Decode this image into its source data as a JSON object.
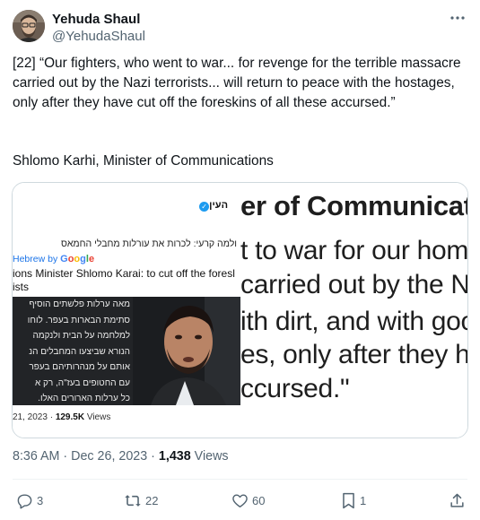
{
  "author": {
    "display_name": "Yehuda Shaul",
    "handle": "@YehudaShaul"
  },
  "tweet": {
    "text": "[22] “Our fighters, who went to war... for revenge for the terrible massacre carried out by the Nazi terrorists... will return to peace with the hostages, only after they have cut off the foreskins of all these accursed.”",
    "signature": "Shlomo Karhi, Minister of Communications"
  },
  "media": {
    "left": {
      "source": "העין",
      "hebrew_headline": "ולמה קרעי: לכרות את עורלות מחבלי החמאס",
      "translated_label": "Hebrew by",
      "google": [
        "G",
        "o",
        "o",
        "g",
        "l",
        "e"
      ],
      "english_headline_1": "ions Minister Shlomo Karai: to cut off the foresl",
      "english_headline_2": "ists",
      "hebrew_block": [
        "מאה ערלות פלשתים הוסיף",
        "סתימת הבארות בעפר. לוחו",
        "למלחמה על הבית ולנקמה",
        "הנורא שביצעו המחבלים הנ",
        "אותם על מנהרותיהם בעפר",
        "עם החטופים בעז\"ה, רק א",
        "כל ערלות הארורים האלו."
      ],
      "date": "21, 2023 · ",
      "views_count": "129.5K",
      "views_label": " Views"
    },
    "right": {
      "lines": [
        "er of Communicati",
        "t to war for our hom",
        "carried out by the Na",
        "ith dirt, and with goo",
        "es, only after they ha",
        "ccursed.\""
      ]
    }
  },
  "meta": {
    "timestamp": "8:36 AM · Dec 26, 2023 · ",
    "views_count": "1,438",
    "views_label": " Views"
  },
  "actions": {
    "replies": "3",
    "reposts": "22",
    "likes": "60",
    "bookmarks": "1"
  },
  "colors": {
    "text": "#0f1419",
    "secondary": "#536471",
    "border": "#cfd9de",
    "link_blue": "#1a73e8",
    "verified": "#1d9bf0"
  }
}
